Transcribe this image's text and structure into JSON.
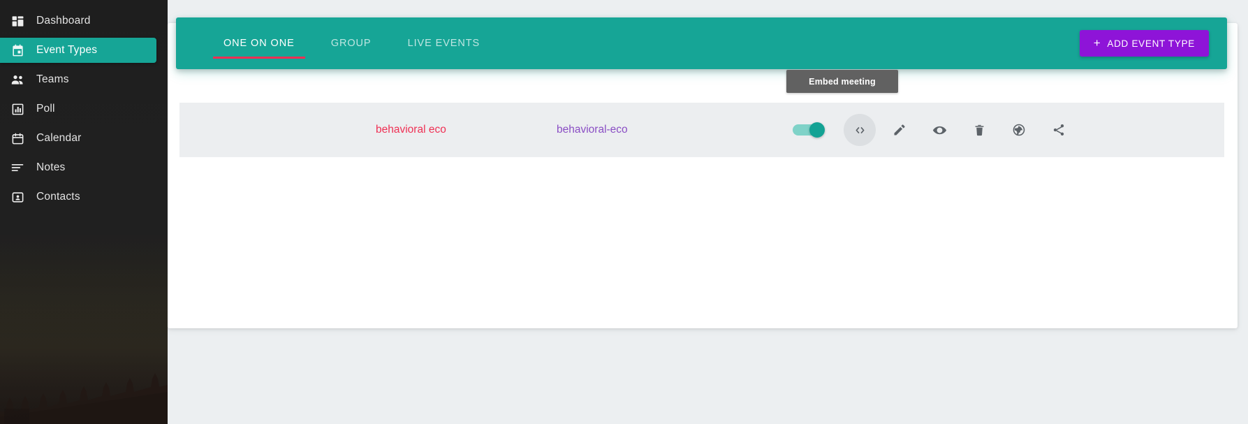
{
  "sidebar": {
    "items": [
      {
        "label": "Dashboard",
        "icon": "dashboard-grid-icon",
        "active": false
      },
      {
        "label": "Event Types",
        "icon": "event-calendar-icon",
        "active": true
      },
      {
        "label": "Teams",
        "icon": "people-group-icon",
        "active": false
      },
      {
        "label": "Poll",
        "icon": "bar-chart-icon",
        "active": false
      },
      {
        "label": "Calendar",
        "icon": "calendar-icon",
        "active": false
      },
      {
        "label": "Notes",
        "icon": "notes-lines-icon",
        "active": false
      },
      {
        "label": "Contacts",
        "icon": "contact-card-icon",
        "active": false
      }
    ]
  },
  "header": {
    "tabs": [
      {
        "label": "ONE ON ONE",
        "active": true
      },
      {
        "label": "GROUP",
        "active": false
      },
      {
        "label": "LIVE EVENTS",
        "active": false
      }
    ],
    "add_button": {
      "label": "ADD EVENT TYPE",
      "plus": "+"
    }
  },
  "events": [
    {
      "title": "behavioral eco",
      "slug": "behavioral-eco",
      "enabled": true,
      "actions": [
        {
          "name": "embed-code",
          "icon": "code-brackets-icon",
          "hovered": true
        },
        {
          "name": "edit",
          "icon": "pencil-icon",
          "hovered": false
        },
        {
          "name": "preview",
          "icon": "eye-icon",
          "hovered": false
        },
        {
          "name": "delete",
          "icon": "trash-icon",
          "hovered": false
        },
        {
          "name": "public-link",
          "icon": "globe-icon",
          "hovered": false
        },
        {
          "name": "share",
          "icon": "share-icon",
          "hovered": false
        }
      ]
    }
  ],
  "tooltip": {
    "text": "Embed meeting"
  },
  "colors": {
    "teal": "#16a596",
    "purple": "#8e14d8",
    "crimson": "#ef3054",
    "slug_purple": "#8a4ec4",
    "sidebar_dark": "#232323",
    "page_bg": "#eceff1",
    "row_bg": "#eceef0",
    "tooltip_bg": "#616161"
  }
}
